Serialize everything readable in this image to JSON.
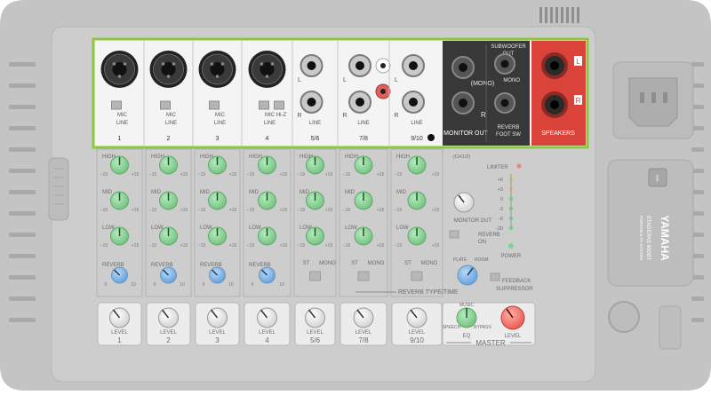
{
  "channels": [
    {
      "number": "1",
      "switch": [
        "MIC",
        "LINE"
      ]
    },
    {
      "number": "2",
      "switch": [
        "MIC",
        "LINE"
      ]
    },
    {
      "number": "3",
      "switch": [
        "MIC",
        "LINE"
      ]
    },
    {
      "number": "4",
      "switch": [
        "MIC",
        "LINE",
        "Hi-Z"
      ]
    },
    {
      "number": "5/6",
      "switch": [
        "LINE"
      ]
    },
    {
      "number": "7/8",
      "switch": [
        "LINE"
      ]
    },
    {
      "number": "9/10",
      "switch": [
        "LINE"
      ]
    }
  ],
  "jack_labels": {
    "L": "L",
    "R": "R"
  },
  "outputs": {
    "mono": "(MONO)",
    "monitor_out": "MONITOR OUT",
    "subwoofer": [
      "SUBWOOFER",
      "OUT"
    ],
    "sub_mono": "MONO",
    "reverb_foot": [
      "REVERB",
      "FOOT SW"
    ],
    "speakers": "SPEAKERS",
    "spk_l": "L",
    "spk_r": "R"
  },
  "eq": {
    "high": "HIGH",
    "mid": "MID",
    "low": "LOW",
    "reverb": "REVERB",
    "min": "−15",
    "max": "+15",
    "rev_min": "0",
    "rev_max": "10"
  },
  "st_mono": [
    "ST",
    "MONO"
  ],
  "master_section": {
    "monitor_ch": "(CH1/2)",
    "limiter": "LIMITER",
    "meter": [
      "+6",
      "+3",
      "0",
      "-3",
      "-6",
      "-20"
    ],
    "monitor_out": "MONITOR OUT",
    "reverb_on": [
      "REVERB",
      "ON"
    ],
    "power": "POWER",
    "feedback": [
      "FEEDBACK",
      "SUPPRESSOR"
    ],
    "reverb_type": "REVERB TYPE/TIME",
    "plate": "PLATE",
    "room": "ROOM",
    "music": "MUSIC",
    "speech": "SPEECH",
    "bypass": "BYPASS",
    "eq_label": "EQ",
    "master": "MASTER",
    "level": "LEVEL"
  },
  "brand": {
    "name": "YAMAHA",
    "model": "STAGEPAS 600BT",
    "sub": "PORTABLE PA SYSTEM"
  },
  "level_labels": [
    "1",
    "2",
    "3",
    "4",
    "5/6",
    "7/8",
    "9/10"
  ],
  "colors": {
    "body": "#c9c9c9",
    "highlight": "#8dc63f",
    "knob_green": "#8fd49a",
    "knob_blue": "#7fb2e6",
    "speaker_red": "#e04438"
  }
}
